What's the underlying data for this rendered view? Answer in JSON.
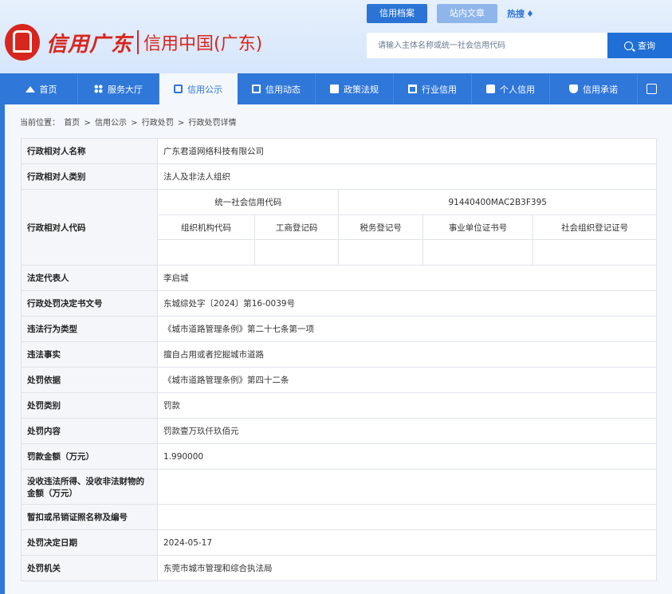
{
  "header": {
    "logo_script": "信用广东",
    "logo_text": "信用中国(广东)",
    "top_tabs": [
      "信用档案",
      "站内文章"
    ],
    "hot_label": "热搜",
    "search_placeholder": "请输入主体名称或统一社会信用代码",
    "search_button": "查询"
  },
  "nav": {
    "items": [
      {
        "label": "首页",
        "icon": "home-icon"
      },
      {
        "label": "服务大厅",
        "icon": "grid-icon"
      },
      {
        "label": "信用公示",
        "icon": "briefcase-icon"
      },
      {
        "label": "信用动态",
        "icon": "document-icon"
      },
      {
        "label": "政策法规",
        "icon": "book-icon"
      },
      {
        "label": "行业信用",
        "icon": "building-icon"
      },
      {
        "label": "个人信用",
        "icon": "id-card-icon"
      },
      {
        "label": "信用承诺",
        "icon": "shield-check-icon"
      }
    ],
    "active": "信用公示"
  },
  "breadcrumb": {
    "prefix": "当前位置：",
    "items": [
      "首页",
      "信用公示",
      "行政处罚",
      "行政处罚详情"
    ],
    "separator": ">"
  },
  "detail": {
    "name_label": "行政相对人名称",
    "name_value": "广东君道网络科技有限公司",
    "type_label": "行政相对人类别",
    "type_value": "法人及非法人组织",
    "code_label": "行政相对人代码",
    "uscc_label": "统一社会信用代码",
    "uscc_value": "91440400MAC2B3F395",
    "code_headers": [
      "组织机构代码",
      "工商登记码",
      "税务登记号",
      "事业单位证书号",
      "社会组织登记证号"
    ],
    "code_values": [
      "",
      "",
      "",
      "",
      ""
    ],
    "rows": [
      {
        "label": "法定代表人",
        "value": "李启城"
      },
      {
        "label": "行政处罚决定书文号",
        "value": "东城综处字〔2024〕第16-0039号"
      },
      {
        "label": "违法行为类型",
        "value": "《城市道路管理条例》第二十七条第一项"
      },
      {
        "label": "违法事实",
        "value": "擅自占用或者挖掘城市道路"
      },
      {
        "label": "处罚依据",
        "value": "《城市道路管理条例》第四十二条"
      },
      {
        "label": "处罚类别",
        "value": "罚款"
      },
      {
        "label": "处罚内容",
        "value": "罚款壹万玖仟玖佰元"
      },
      {
        "label": "罚款金额（万元）",
        "value": "1.990000"
      },
      {
        "label": "没收违法所得、没收非法财物的金额（万元）",
        "value": ""
      },
      {
        "label": "暂扣或吊销证照名称及编号",
        "value": ""
      },
      {
        "label": "处罚决定日期",
        "value": "2024-05-17"
      },
      {
        "label": "处罚机关",
        "value": "东莞市城市管理和综合执法局"
      }
    ]
  },
  "colors": {
    "brand_red": "#d7261e",
    "nav_blue": "#2f77d9",
    "active_tab_blue": "#2b74d6"
  }
}
